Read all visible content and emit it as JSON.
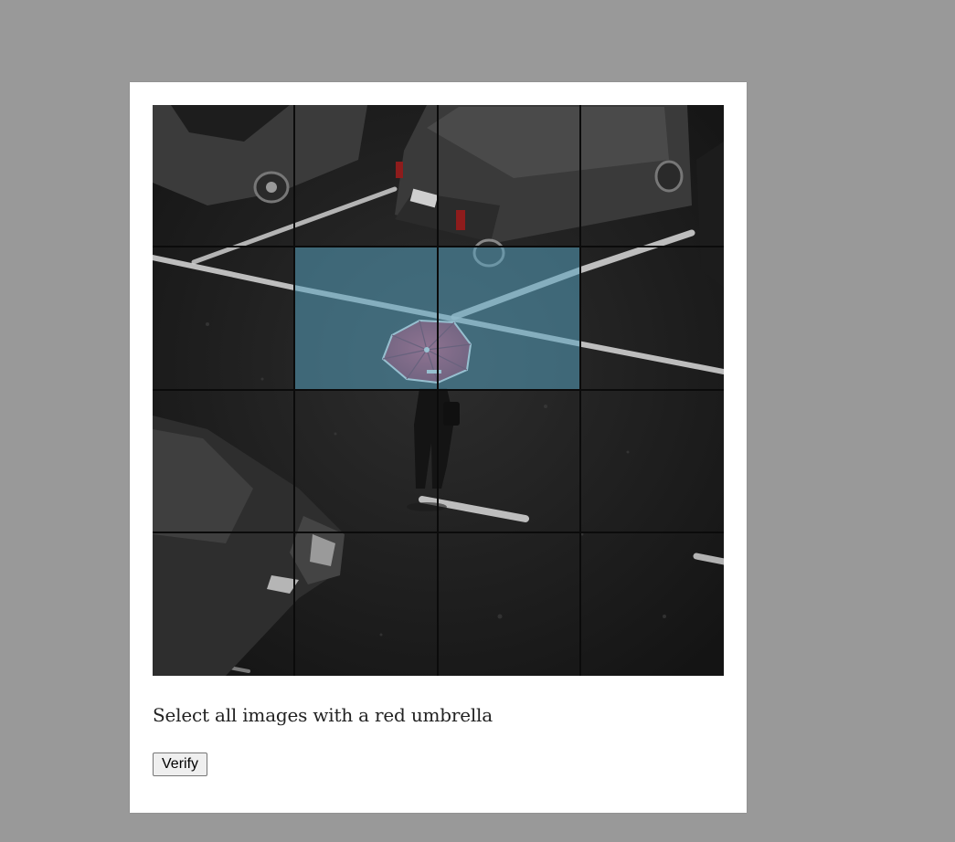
{
  "captcha": {
    "prompt": "Select all images with a red umbrella",
    "verify_label": "Verify",
    "grid": {
      "rows": 4,
      "columns": 4,
      "tiles": [
        {
          "row": 1,
          "col": 1,
          "selected": false
        },
        {
          "row": 1,
          "col": 2,
          "selected": false
        },
        {
          "row": 1,
          "col": 3,
          "selected": false
        },
        {
          "row": 1,
          "col": 4,
          "selected": false
        },
        {
          "row": 2,
          "col": 1,
          "selected": false
        },
        {
          "row": 2,
          "col": 2,
          "selected": true
        },
        {
          "row": 2,
          "col": 3,
          "selected": true
        },
        {
          "row": 2,
          "col": 4,
          "selected": false
        },
        {
          "row": 3,
          "col": 1,
          "selected": false
        },
        {
          "row": 3,
          "col": 2,
          "selected": false
        },
        {
          "row": 3,
          "col": 3,
          "selected": false
        },
        {
          "row": 3,
          "col": 4,
          "selected": false
        },
        {
          "row": 4,
          "col": 1,
          "selected": false
        },
        {
          "row": 4,
          "col": 2,
          "selected": false
        },
        {
          "row": 4,
          "col": 3,
          "selected": false
        },
        {
          "row": 4,
          "col": 4,
          "selected": false
        }
      ]
    },
    "colors": {
      "page_background": "#999999",
      "card_background": "#ffffff",
      "selection_overlay": "#56a0be",
      "umbrella": "#c8284a",
      "asphalt": "#242424"
    }
  }
}
